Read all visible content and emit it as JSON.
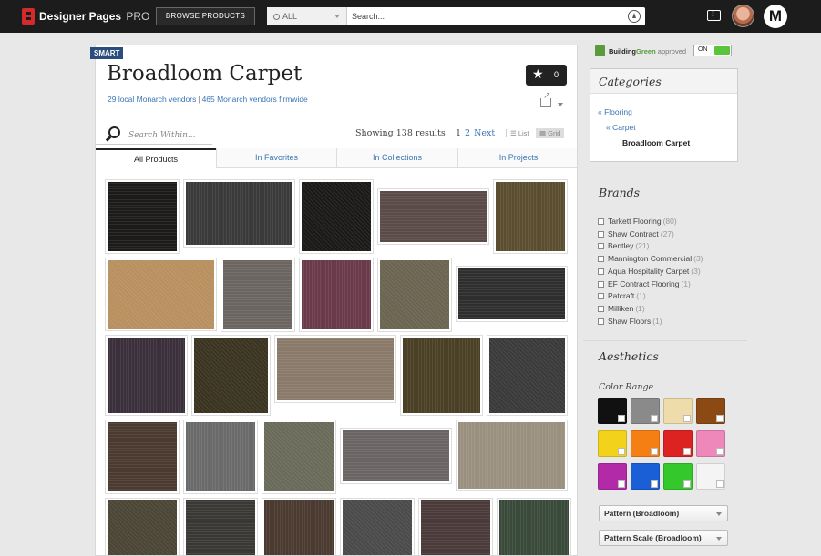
{
  "header": {
    "app_name": "Designer Pages",
    "app_suffix": "PRO",
    "browse_label": "BROWSE PRODUCTS",
    "search_scope": "ALL",
    "search_placeholder": "Search...",
    "avatar_logo": "M"
  },
  "page": {
    "badge": "SMART",
    "title": "Broadloom Carpet",
    "local_vendors": "29 local Monarch vendors",
    "vendor_separator": "|",
    "firmwide_vendors": "465 Monarch vendors firmwide",
    "favorites_count": "0",
    "search_within_placeholder": "Search Within...",
    "results_text": "Showing 138 results",
    "pages": [
      "1",
      "2"
    ],
    "next_label": "Next",
    "list_label": "List",
    "grid_label": "Grid"
  },
  "tabs": [
    "All Products",
    "In Favorites",
    "In Collections",
    "In Projects"
  ],
  "swatch_colors": [
    "#1d1b1a",
    "#3a3a3a",
    "#1a1918",
    "#5a4a48",
    "#5a4d30",
    "#b89060",
    "#6a6560",
    "#6a3a4a",
    "#6a6450",
    "#2e2e2e",
    "#3a2f3a",
    "#3a3320",
    "#8a7a6a",
    "#4a4025",
    "#3a3a3a",
    "#4a3a30",
    "#6a6a6a",
    "#6a6a5a",
    "#6a6464",
    "#9a9080",
    "#4a4535",
    "#3a3835",
    "#4a3a30",
    "#4a4a4a",
    "#4a3a3a",
    "#3a4a3a"
  ],
  "sidebar": {
    "buildinggreen_building": "Building",
    "buildinggreen_green": "Green",
    "buildinggreen_approved": "approved",
    "toggle_label": "ON",
    "categories_title": "Categories",
    "category_links": [
      "Flooring",
      "Carpet"
    ],
    "category_current": "Broadloom Carpet",
    "brands_title": "Brands",
    "brands": [
      {
        "name": "Tarkett Flooring",
        "count": "(80)"
      },
      {
        "name": "Shaw Contract",
        "count": "(27)"
      },
      {
        "name": "Bentley",
        "count": "(21)"
      },
      {
        "name": "Mannington Commercial",
        "count": "(3)"
      },
      {
        "name": "Aqua Hospitality Carpet",
        "count": "(3)"
      },
      {
        "name": "EF Contract Flooring",
        "count": "(1)"
      },
      {
        "name": "Patcraft",
        "count": "(1)"
      },
      {
        "name": "Milliken",
        "count": "(1)"
      },
      {
        "name": "Shaw Floors",
        "count": "(1)"
      }
    ],
    "aesthetics_title": "Aesthetics",
    "color_range_label": "Color Range",
    "colors": [
      "#111111",
      "#8a8a8a",
      "#eedcaa",
      "#8b4a14",
      "#f2d21a",
      "#f57f12",
      "#dd2222",
      "#ee88bb",
      "#b22aa8",
      "#1a5fd6",
      "#35c82c",
      "#f4f4f4"
    ],
    "pattern_dropdown": "Pattern (Broadloom)",
    "pattern_scale_dropdown": "Pattern Scale (Broadloom)"
  }
}
